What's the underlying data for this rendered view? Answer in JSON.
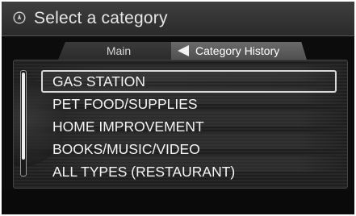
{
  "header": {
    "icon": "compass-icon",
    "title": "Select a category"
  },
  "tabs": [
    {
      "label": "Main",
      "active": false
    },
    {
      "label": "Category History",
      "active": true
    }
  ],
  "list": {
    "items": [
      {
        "label": "GAS STATION",
        "selected": true
      },
      {
        "label": "PET FOOD/SUPPLIES",
        "selected": false
      },
      {
        "label": "HOME IMPROVEMENT",
        "selected": false
      },
      {
        "label": "BOOKS/MUSIC/VIDEO",
        "selected": false
      },
      {
        "label": "ALL TYPES (RESTAURANT)",
        "selected": false
      }
    ]
  },
  "colors": {
    "background": "#0c0c0c",
    "text": "#f4f4f4",
    "highlight": "#d9d9d9"
  }
}
